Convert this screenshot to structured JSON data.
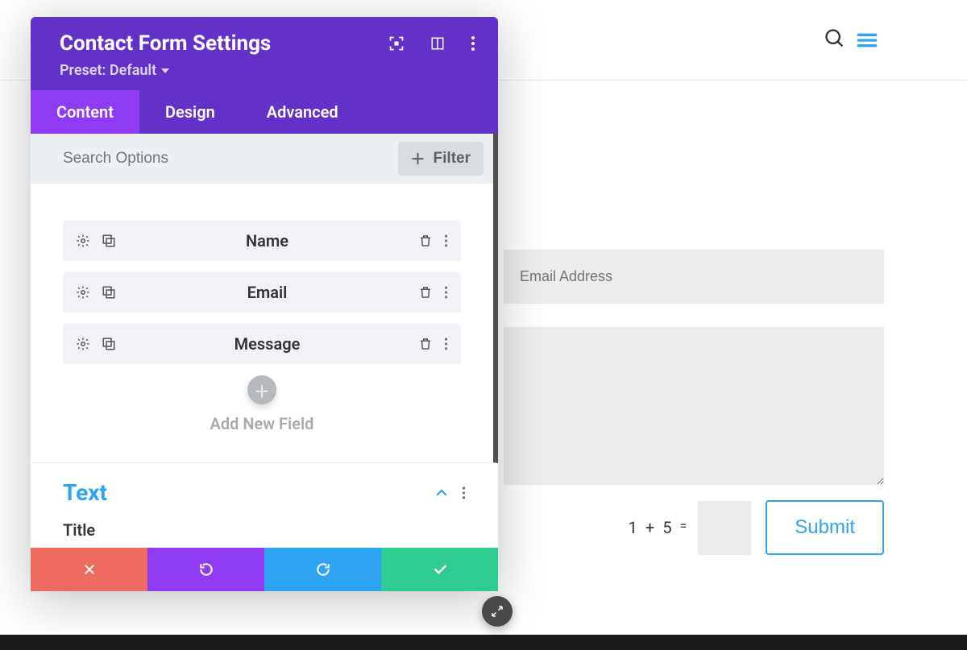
{
  "page": {
    "title": "Contact Form Settings"
  },
  "modal": {
    "title": "Contact Form Settings",
    "preset_label": "Preset: Default",
    "tabs": {
      "content": "Content",
      "design": "Design",
      "advanced": "Advanced"
    },
    "search_placeholder": "Search Options",
    "filter_label": "Filter",
    "fields": [
      {
        "label": "Name"
      },
      {
        "label": "Email"
      },
      {
        "label": "Message"
      }
    ],
    "add_new_label": "Add New Field",
    "text_section": {
      "heading": "Text",
      "title_label": "Title"
    }
  },
  "preview": {
    "email_placeholder": "Email Address",
    "captcha": {
      "a": "1",
      "op": "+",
      "b": "5",
      "eq": "="
    },
    "submit_label": "Submit"
  },
  "colors": {
    "header": "#6232C8",
    "tab_active": "#8F3BF4",
    "accent": "#2ea3f2",
    "save": "#2ecc91",
    "cancel": "#ec6a5e"
  }
}
